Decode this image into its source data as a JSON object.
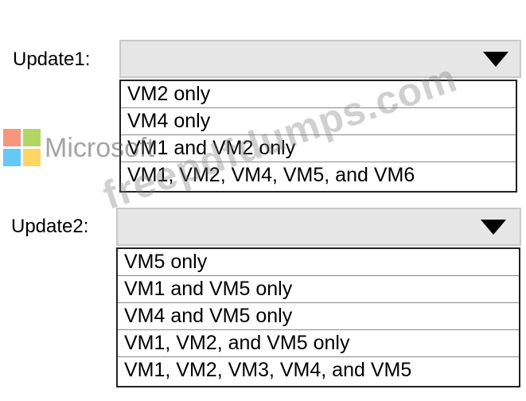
{
  "groups": [
    {
      "label": "Update1:",
      "selected_value": "",
      "options": [
        "VM2 only",
        "VM4 only",
        "VM1 and VM2 only",
        "VM1, VM2, VM4, VM5, and VM6"
      ]
    },
    {
      "label": "Update2:",
      "selected_value": "",
      "options": [
        "VM5 only",
        "VM1 and VM5 only",
        "VM4 and VM5 only",
        "VM1, VM2, and VM5 only",
        "VM1, VM2, VM3, VM4, and VM5"
      ]
    }
  ],
  "watermark": {
    "logo_text": "Microsoft",
    "site_text": "freepdfdumps.com",
    "logo_colors": [
      "#f25022",
      "#7fba00",
      "#00a4ef",
      "#ffb900"
    ]
  },
  "colors": {
    "dropdown_background": "#e6e6e6",
    "dropdown_border": "#c8c8c8",
    "arrow": "#000000"
  },
  "icons": {
    "dropdown_arrow": "chevron-down-icon",
    "logo": "microsoft-logo-icon"
  }
}
